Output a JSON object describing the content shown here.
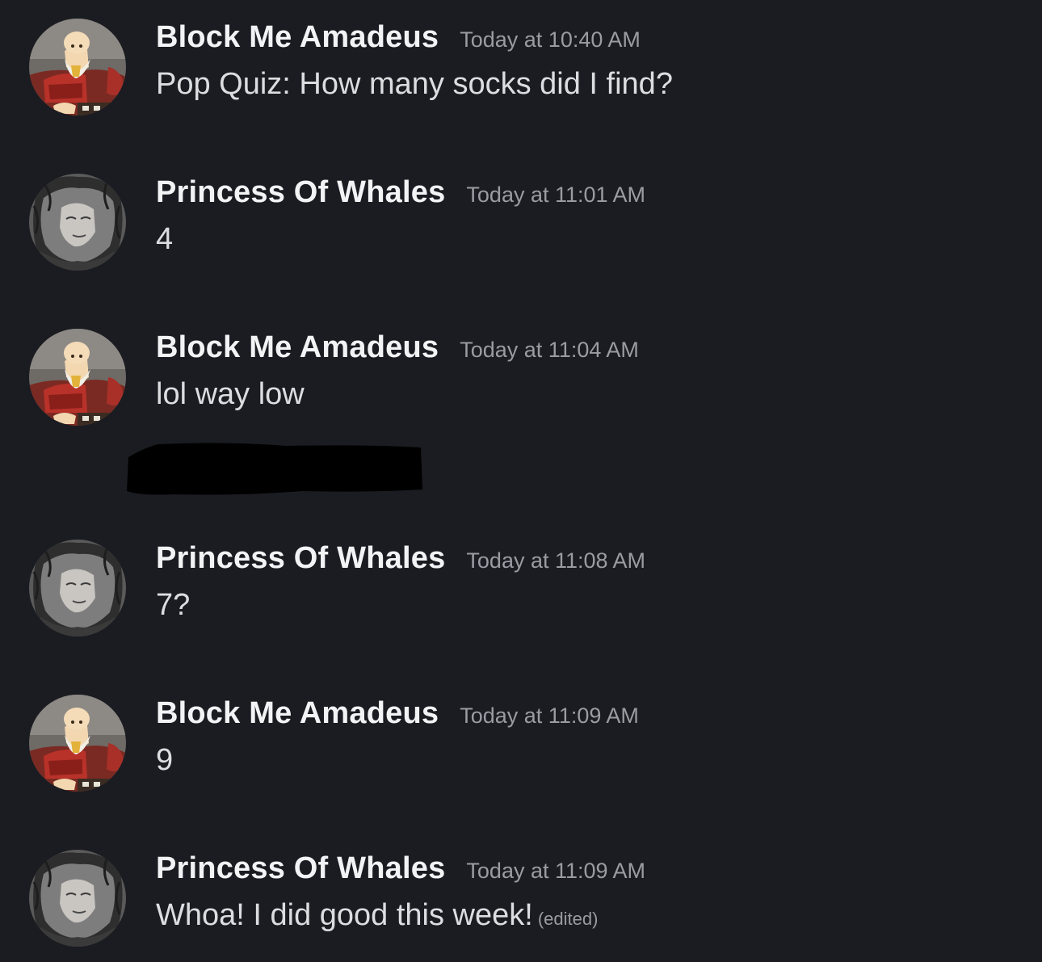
{
  "messages": [
    {
      "username": "Block Me Amadeus",
      "timestamp": "Today at 10:40 AM",
      "content": "Pop Quiz: How many socks did I find?",
      "avatar_icon": "old-man-cartoon-avatar-icon"
    },
    {
      "username": "Princess Of Whales",
      "timestamp": "Today at 11:01 AM",
      "content": "4",
      "avatar_icon": "grayscale-portrait-avatar-icon"
    },
    {
      "username": "Block Me Amadeus",
      "timestamp": "Today at 11:04 AM",
      "content": "lol way low",
      "avatar_icon": "old-man-cartoon-avatar-icon"
    },
    {
      "username": "Princess Of Whales",
      "timestamp": "Today at 11:08 AM",
      "content": "7?",
      "avatar_icon": "grayscale-portrait-avatar-icon"
    },
    {
      "username": "Block Me Amadeus",
      "timestamp": "Today at 11:09 AM",
      "content": "9",
      "avatar_icon": "old-man-cartoon-avatar-icon"
    },
    {
      "username": "Princess Of Whales",
      "timestamp": "Today at 11:09 AM",
      "content": "Whoa! I did good this week!",
      "edited_label": "(edited)",
      "avatar_icon": "grayscale-portrait-avatar-icon"
    }
  ],
  "colors": {
    "background": "#1b1c21",
    "username": "#f2f3f5",
    "timestamp": "#9a9ca3",
    "message_text": "#dbdee1",
    "redaction": "#000000"
  }
}
